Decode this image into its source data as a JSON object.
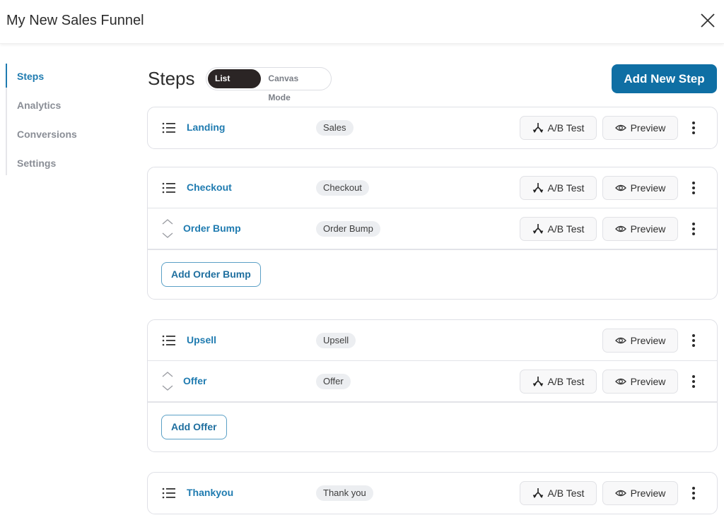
{
  "window": {
    "title": "My New Sales Funnel",
    "close_icon": "close-icon"
  },
  "sidebar": {
    "items": [
      {
        "label": "Steps",
        "active": true
      },
      {
        "label": "Analytics",
        "active": false
      },
      {
        "label": "Conversions",
        "active": false
      },
      {
        "label": "Settings",
        "active": false
      }
    ]
  },
  "main": {
    "title": "Steps",
    "modes": [
      {
        "label": "List Mode",
        "active": true
      },
      {
        "label": "Canvas Mode",
        "active": false
      }
    ],
    "add_step_label": "Add New Step",
    "ab_test_label": "A/B Test",
    "preview_label": "Preview",
    "groups": [
      {
        "steps": [
          {
            "name": "Landing",
            "tag": "Sales",
            "ab_test": true,
            "sub": false
          }
        ]
      },
      {
        "steps": [
          {
            "name": "Checkout",
            "tag": "Checkout",
            "ab_test": true,
            "sub": false
          },
          {
            "name": "Order Bump",
            "tag": "Order Bump",
            "ab_test": true,
            "sub": true
          }
        ],
        "add_label": "Add Order Bump"
      },
      {
        "steps": [
          {
            "name": "Upsell",
            "tag": "Upsell",
            "ab_test": false,
            "sub": false
          },
          {
            "name": "Offer",
            "tag": "Offer",
            "ab_test": true,
            "sub": true
          }
        ],
        "add_label": "Add Offer"
      },
      {
        "steps": [
          {
            "name": "Thankyou",
            "tag": "Thank you",
            "ab_test": true,
            "sub": false
          }
        ]
      }
    ]
  },
  "colors": {
    "accent": "#1f7bb0",
    "primary_button": "#0f6fa4",
    "toggle_active": "#2b2525"
  }
}
